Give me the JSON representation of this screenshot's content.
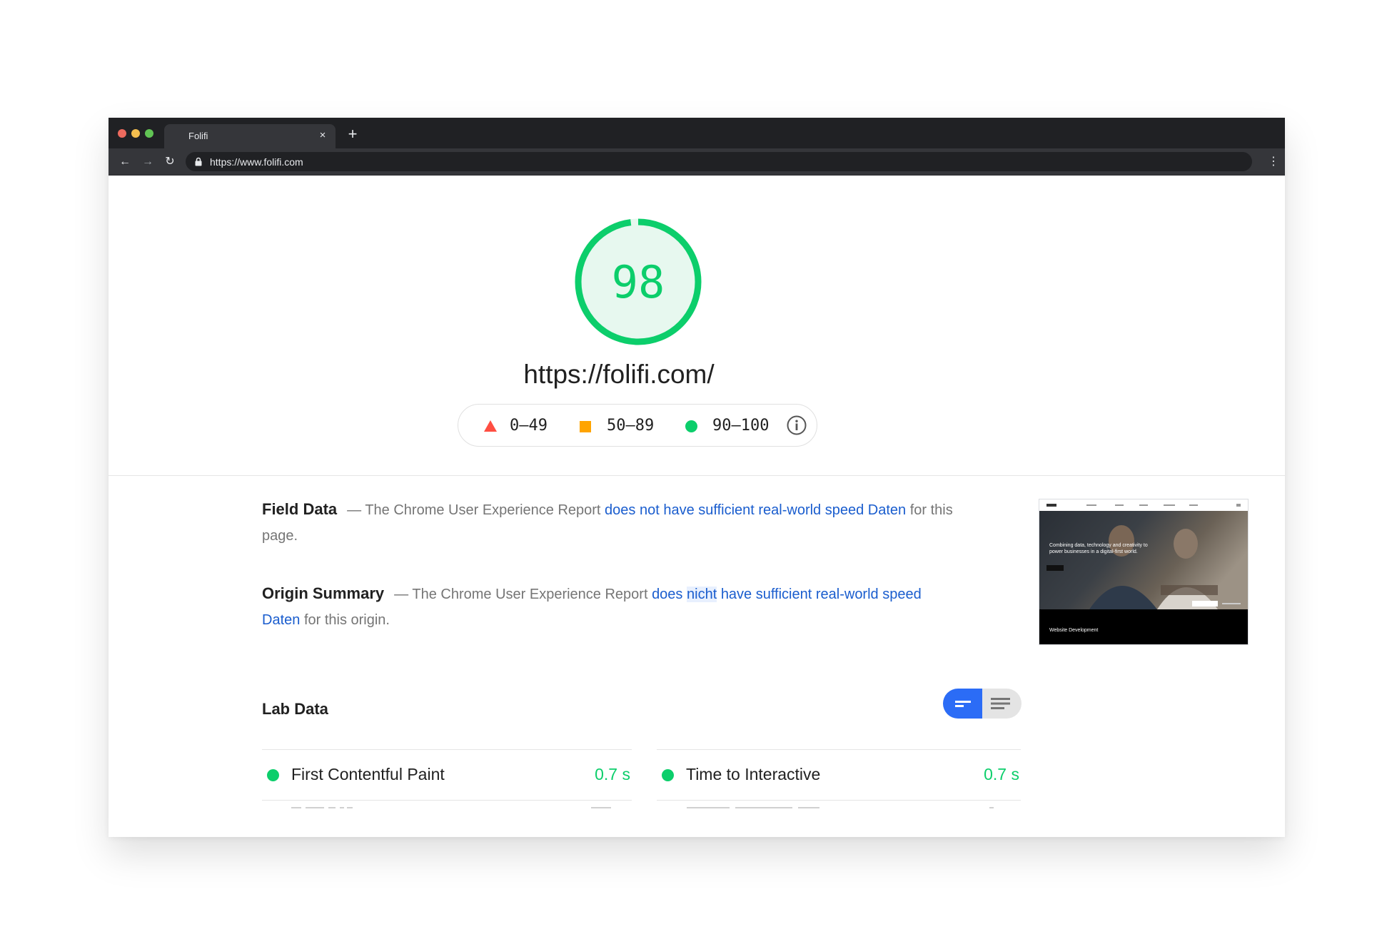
{
  "browser": {
    "tab_title": "Folifi",
    "tab_close": "×",
    "new_tab": "+",
    "url": "https://www.folifi.com",
    "back": "←",
    "forward": "→",
    "reload": "↻",
    "menu": "⋮",
    "icons": [
      "back-arrow-icon",
      "forward-arrow-icon",
      "reload-icon",
      "lock-icon",
      "kebab-menu-icon"
    ]
  },
  "score": {
    "value": "98",
    "fraction": 0.98,
    "final_url": "https://folifi.com/",
    "color": "#0cce6b",
    "track_color": "#e7f8ef"
  },
  "legend": {
    "fail": "0–49",
    "average": "50–89",
    "pass": "90–100",
    "colors": {
      "fail": "#ff4e42",
      "average": "#ffa400",
      "pass": "#0cce6b"
    },
    "info_icon": "info-icon"
  },
  "field_data": {
    "title": "Field Data",
    "dash": "—",
    "prefix": "The Chrome User Experience Report",
    "link": "does not have sufficient real-world speed Daten",
    "suffix": "for this page."
  },
  "origin_summary": {
    "title": "Origin Summary",
    "dash": "—",
    "prefix": "The Chrome User Experience Report",
    "link_before": "does",
    "link_highlight": "nicht",
    "link_after": "have sufficient real-world speed Daten",
    "suffix": "for this origin."
  },
  "thumbnail": {
    "hero_text": "Combining data, technology and creativity to power businesses in a digital-first world.",
    "footer_text": "Website Development"
  },
  "lab_data": {
    "title": "Lab Data",
    "toggle_icons": [
      "compact-view-icon",
      "expanded-view-icon"
    ],
    "metrics": [
      {
        "label": "First Contentful Paint",
        "value": "0.7 s"
      },
      {
        "label": "Time to Interactive",
        "value": "0.7 s"
      }
    ]
  }
}
